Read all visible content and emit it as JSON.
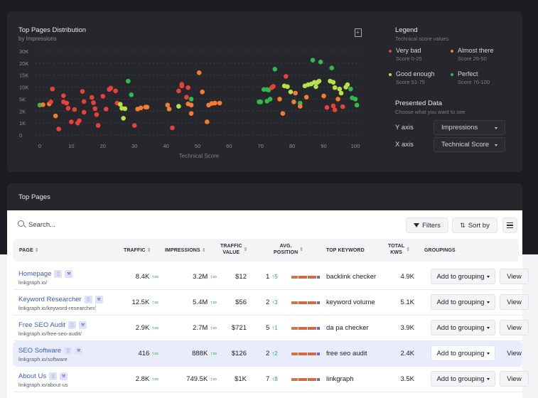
{
  "distribution": {
    "title": "Top Pages Distribution",
    "subtitle": "by Impressions",
    "export_icon": "file-export-icon"
  },
  "chart_data": {
    "type": "scatter",
    "title": "Top Pages Distribution",
    "subtitle": "by Impressions",
    "xlabel": "Technical Score",
    "ylabel": "Impressions",
    "x_ticks": [
      "0",
      "10",
      "20",
      "30",
      "40",
      "50",
      "60",
      "70",
      "80",
      "90",
      "100"
    ],
    "x_range": [
      0,
      100
    ],
    "y_ticks": [
      "0",
      "1K",
      "2K",
      "5K",
      "10K",
      "15K",
      "20K",
      "30K"
    ],
    "y_tick_values": [
      0,
      1000,
      2000,
      5000,
      10000,
      15000,
      20000,
      30000
    ],
    "grid": "horizontal dotted",
    "color_rule": {
      "very_bad": "#e8413a",
      "almost_there": "#f47c30",
      "good_enough": "#b8e04a",
      "perfect": "#34b84a"
    },
    "points": [
      {
        "x": 0,
        "y": 3500,
        "c": "perfect"
      },
      {
        "x": 1,
        "y": 3600,
        "c": "almost_there"
      },
      {
        "x": 3,
        "y": 3800,
        "c": "almost_there"
      },
      {
        "x": 3.5,
        "y": 4300,
        "c": "very_bad"
      },
      {
        "x": 4,
        "y": 9200,
        "c": "very_bad"
      },
      {
        "x": 5,
        "y": 1600,
        "c": "almost_there"
      },
      {
        "x": 6,
        "y": 500,
        "c": "very_bad"
      },
      {
        "x": 7.5,
        "y": 6400,
        "c": "very_bad"
      },
      {
        "x": 7.5,
        "y": 4300,
        "c": "very_bad"
      },
      {
        "x": 8.5,
        "y": 4000,
        "c": "very_bad"
      },
      {
        "x": 9,
        "y": 2700,
        "c": "very_bad"
      },
      {
        "x": 10,
        "y": 1100,
        "c": "very_bad"
      },
      {
        "x": 11,
        "y": 2400,
        "c": "very_bad"
      },
      {
        "x": 12,
        "y": 1000,
        "c": "very_bad"
      },
      {
        "x": 12.5,
        "y": 1200,
        "c": "very_bad"
      },
      {
        "x": 13.5,
        "y": 8200,
        "c": "very_bad"
      },
      {
        "x": 14,
        "y": 4400,
        "c": "very_bad"
      },
      {
        "x": 14,
        "y": 1900,
        "c": "very_bad"
      },
      {
        "x": 16.5,
        "y": 5700,
        "c": "very_bad"
      },
      {
        "x": 17,
        "y": 4100,
        "c": "very_bad"
      },
      {
        "x": 17.5,
        "y": 2600,
        "c": "very_bad"
      },
      {
        "x": 18,
        "y": 1700,
        "c": "very_bad"
      },
      {
        "x": 18.5,
        "y": 800,
        "c": "very_bad"
      },
      {
        "x": 20,
        "y": 6200,
        "c": "very_bad"
      },
      {
        "x": 21,
        "y": 2500,
        "c": "very_bad"
      },
      {
        "x": 22,
        "y": 9000,
        "c": "very_bad"
      },
      {
        "x": 22.5,
        "y": 9600,
        "c": "very_bad"
      },
      {
        "x": 24,
        "y": 8400,
        "c": "very_bad"
      },
      {
        "x": 24.5,
        "y": 4000,
        "c": "very_bad"
      },
      {
        "x": 25.5,
        "y": 3700,
        "c": "good_enough"
      },
      {
        "x": 26,
        "y": 2700,
        "c": "good_enough"
      },
      {
        "x": 26.5,
        "y": 1400,
        "c": "good_enough"
      },
      {
        "x": 27,
        "y": 2600,
        "c": "good_enough"
      },
      {
        "x": 28,
        "y": 12500,
        "c": "perfect"
      },
      {
        "x": 29,
        "y": 6800,
        "c": "perfect"
      },
      {
        "x": 30,
        "y": 800,
        "c": "very_bad"
      },
      {
        "x": 31,
        "y": 2500,
        "c": "almost_there"
      },
      {
        "x": 32,
        "y": 2800,
        "c": "almost_there"
      },
      {
        "x": 33.5,
        "y": 3000,
        "c": "almost_there"
      },
      {
        "x": 34,
        "y": 3000,
        "c": "almost_there"
      },
      {
        "x": 40.5,
        "y": 3500,
        "c": "almost_there"
      },
      {
        "x": 41,
        "y": 2500,
        "c": "almost_there"
      },
      {
        "x": 42,
        "y": 600,
        "c": "very_bad"
      },
      {
        "x": 44,
        "y": 8400,
        "c": "very_bad"
      },
      {
        "x": 44,
        "y": 3200,
        "c": "good_enough"
      },
      {
        "x": 45,
        "y": 10500,
        "c": "very_bad"
      },
      {
        "x": 45,
        "y": 11200,
        "c": "very_bad"
      },
      {
        "x": 47,
        "y": 9800,
        "c": "very_bad"
      },
      {
        "x": 46.5,
        "y": 5800,
        "c": "very_bad"
      },
      {
        "x": 48,
        "y": 5000,
        "c": "perfect"
      },
      {
        "x": 47,
        "y": 3800,
        "c": "almost_there"
      },
      {
        "x": 48,
        "y": 3500,
        "c": "almost_there"
      },
      {
        "x": 48,
        "y": 1800,
        "c": "almost_there"
      },
      {
        "x": 50.5,
        "y": 16000,
        "c": "almost_there"
      },
      {
        "x": 51.5,
        "y": 8000,
        "c": "almost_there"
      },
      {
        "x": 53,
        "y": 1100,
        "c": "almost_there"
      },
      {
        "x": 53.5,
        "y": 3500,
        "c": "almost_there"
      },
      {
        "x": 54.5,
        "y": 3900,
        "c": "almost_there"
      },
      {
        "x": 55.5,
        "y": 4000,
        "c": "almost_there"
      },
      {
        "x": 57,
        "y": 4000,
        "c": "almost_there"
      },
      {
        "x": 69.5,
        "y": 4300,
        "c": "perfect"
      },
      {
        "x": 70,
        "y": 4300,
        "c": "perfect"
      },
      {
        "x": 71,
        "y": 9000,
        "c": "perfect"
      },
      {
        "x": 72,
        "y": 9000,
        "c": "perfect"
      },
      {
        "x": 72,
        "y": 4500,
        "c": "perfect"
      },
      {
        "x": 73,
        "y": 5000,
        "c": "perfect"
      },
      {
        "x": 72.5,
        "y": 8800,
        "c": "perfect"
      },
      {
        "x": 73.5,
        "y": 9800,
        "c": "very_bad"
      },
      {
        "x": 74,
        "y": 10300,
        "c": "very_bad"
      },
      {
        "x": 74.5,
        "y": 17500,
        "c": "perfect"
      },
      {
        "x": 76,
        "y": 5000,
        "c": "almost_there"
      },
      {
        "x": 77,
        "y": 1800,
        "c": "almost_there"
      },
      {
        "x": 78,
        "y": 14500,
        "c": "very_bad"
      },
      {
        "x": 77.5,
        "y": 10500,
        "c": "good_enough"
      },
      {
        "x": 78.5,
        "y": 10200,
        "c": "good_enough"
      },
      {
        "x": 79.5,
        "y": 8000,
        "c": "good_enough"
      },
      {
        "x": 80.5,
        "y": 4300,
        "c": "almost_there"
      },
      {
        "x": 81,
        "y": 7500,
        "c": "almost_there"
      },
      {
        "x": 82.5,
        "y": 4000,
        "c": "perfect"
      },
      {
        "x": 82.5,
        "y": 3200,
        "c": "almost_there"
      },
      {
        "x": 84,
        "y": 10500,
        "c": "good_enough"
      },
      {
        "x": 84.5,
        "y": 5800,
        "c": "almost_there"
      },
      {
        "x": 85,
        "y": 11000,
        "c": "good_enough"
      },
      {
        "x": 86,
        "y": 11300,
        "c": "good_enough"
      },
      {
        "x": 86.5,
        "y": 22500,
        "c": "perfect"
      },
      {
        "x": 87,
        "y": 12000,
        "c": "good_enough"
      },
      {
        "x": 87.5,
        "y": 10200,
        "c": "good_enough"
      },
      {
        "x": 88,
        "y": 12000,
        "c": "good_enough"
      },
      {
        "x": 88.5,
        "y": 12500,
        "c": "good_enough"
      },
      {
        "x": 89,
        "y": 21000,
        "c": "perfect"
      },
      {
        "x": 90,
        "y": 6300,
        "c": "almost_there"
      },
      {
        "x": 91,
        "y": 2900,
        "c": "very_bad"
      },
      {
        "x": 92,
        "y": 12500,
        "c": "good_enough"
      },
      {
        "x": 92.5,
        "y": 18000,
        "c": "perfect"
      },
      {
        "x": 93,
        "y": 12000,
        "c": "good_enough"
      },
      {
        "x": 93,
        "y": 3300,
        "c": "very_bad"
      },
      {
        "x": 93.5,
        "y": 2300,
        "c": "very_bad"
      },
      {
        "x": 93.5,
        "y": 9800,
        "c": "good_enough"
      },
      {
        "x": 94.5,
        "y": 5000,
        "c": "almost_there"
      },
      {
        "x": 95,
        "y": 9200,
        "c": "good_enough"
      },
      {
        "x": 95.5,
        "y": 7500,
        "c": "good_enough"
      },
      {
        "x": 96,
        "y": 3100,
        "c": "very_bad"
      },
      {
        "x": 97,
        "y": 10000,
        "c": "good_enough"
      },
      {
        "x": 97.5,
        "y": 11000,
        "c": "good_enough"
      },
      {
        "x": 98.5,
        "y": 9200,
        "c": "perfect"
      },
      {
        "x": 99,
        "y": 5500,
        "c": "perfect"
      },
      {
        "x": 100,
        "y": 5000,
        "c": "perfect"
      },
      {
        "x": 100.5,
        "y": 3500,
        "c": "perfect"
      }
    ]
  },
  "legend": {
    "title": "Legend",
    "subtitle": "Technical score values",
    "items": [
      {
        "name": "Very bad",
        "range": "Score 0-25",
        "color": "#e8413a"
      },
      {
        "name": "Almost there",
        "range": "Score 26-50",
        "color": "#f47c30"
      },
      {
        "name": "Good enough",
        "range": "Score 51-75",
        "color": "#b8e04a"
      },
      {
        "name": "Perfect",
        "range": "Score 76-100",
        "color": "#34b84a"
      }
    ]
  },
  "presented_data": {
    "title": "Presented Data",
    "subtitle": "Choose what you want to see",
    "y_axis_label": "Y axis",
    "y_axis_value": "Impressions",
    "x_axis_label": "X axis",
    "x_axis_value": "Technical Score"
  },
  "top_pages": {
    "title": "Top Pages",
    "search_placeholder": "Search...",
    "filters_label": "Filters",
    "sort_label": "Sort by",
    "columns": {
      "page": "PAGE",
      "traffic": "TRAFFIC",
      "impressions": "IMPRESSIONS",
      "traffic_value_1": "TRAFFIC",
      "traffic_value_2": "VALUE",
      "avg_position_1": "AVG.",
      "avg_position_2": "POSITION",
      "top_keyword": "TOP KEYWORD",
      "total_kws_1": "TOTAL",
      "total_kws_2": "KWS",
      "groupings": "GROUPINGS"
    },
    "sort_glyph": "↕",
    "infinity_trend": "↑∞",
    "grouping_label": "Add to grouping",
    "view_label": "View",
    "rows": [
      {
        "name": "Homepage",
        "url": "linkgraph.io/",
        "traffic": "8.4K",
        "impressions": "3.2M",
        "value": "$12",
        "position": "1",
        "pos_change": "↑5",
        "keyword": "backlink checker",
        "kws": "4.9K",
        "highlight": false
      },
      {
        "name": "Keyword Researcher",
        "url": "linkgraph.io/keyword-researcher/",
        "traffic": "12.5K",
        "impressions": "5.4M",
        "value": "$56",
        "position": "2",
        "pos_change": "↑3",
        "keyword": "keyword volume",
        "kws": "5.1K",
        "highlight": false
      },
      {
        "name": "Free SEO Audit",
        "url": "linkgraph.io/free-seo-audit/",
        "traffic": "2.9K",
        "impressions": "2.7M",
        "value": "$721",
        "position": "5",
        "pos_change": "↑1",
        "keyword": "da pa checker",
        "kws": "3.9K",
        "highlight": false
      },
      {
        "name": "SEO Software",
        "url": "linkgraph.io/software",
        "traffic": "416",
        "impressions": "888K",
        "value": "$126",
        "position": "2",
        "pos_change": "↑2",
        "keyword": "free seo audit",
        "kws": "2.4K",
        "highlight": true
      },
      {
        "name": "About Us",
        "url": "linkgraph.io/about-us",
        "traffic": "2.8K",
        "impressions": "749.5K",
        "value": "$1K",
        "position": "7",
        "pos_change": "↑8",
        "keyword": "linkgraph",
        "kws": "3.5K",
        "highlight": false
      }
    ]
  }
}
